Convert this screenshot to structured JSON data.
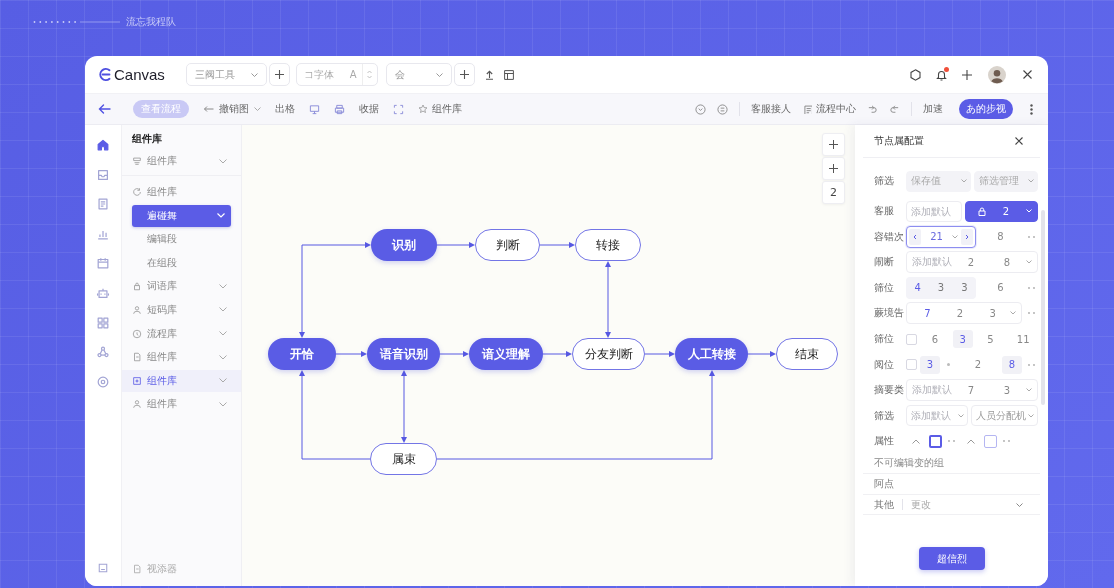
{
  "backdrop": {
    "caption": "流忘我程队"
  },
  "header": {
    "logo": "Canvas",
    "tool_select": {
      "value": "三阀工具"
    },
    "font_field": {
      "placeholder": "コ字体",
      "suffix": "A"
    },
    "style_select": {
      "value": "会"
    },
    "notifications": {
      "unread": true
    }
  },
  "toolbar": {
    "view_button": {
      "label": "查看流程",
      "disabled": true
    },
    "undo_menu": {
      "label": "撤销图"
    },
    "left_items": [
      {
        "kind": "text",
        "label": "出格"
      },
      {
        "kind": "icon"
      },
      {
        "kind": "icon"
      },
      {
        "kind": "text",
        "label": "收据"
      },
      {
        "kind": "icon"
      },
      {
        "kind": "icon-text",
        "label": "组件库"
      }
    ],
    "right_items": [
      {
        "kind": "icon"
      },
      {
        "kind": "icon"
      },
      {
        "kind": "divider"
      },
      {
        "kind": "text",
        "label": "客服接人"
      },
      {
        "kind": "icon-text",
        "label": "流程中心"
      },
      {
        "kind": "icon"
      },
      {
        "kind": "icon"
      },
      {
        "kind": "divider"
      },
      {
        "kind": "text",
        "label": "加速"
      }
    ],
    "primary_button": {
      "label": "あ的步视"
    }
  },
  "rail": {
    "items": [
      {
        "selected": true
      },
      {
        "selected": false
      },
      {
        "selected": false
      },
      {
        "selected": false
      },
      {
        "selected": false
      },
      {
        "selected": false
      },
      {
        "selected": false
      },
      {
        "selected": false
      },
      {
        "selected": false
      }
    ]
  },
  "components": {
    "title": "组件库",
    "category": {
      "label": "组件库"
    },
    "items": [
      {
        "label": "组件库",
        "expandable": false,
        "selected": false,
        "highlighted": false,
        "children": [
          {
            "label": "遍碰舞",
            "expandable": true,
            "selected": true,
            "highlighted": false
          },
          {
            "label": "编辑段",
            "expandable": false,
            "selected": false,
            "highlighted": false
          },
          {
            "label": "在组段",
            "expandable": false,
            "selected": false,
            "highlighted": false
          }
        ]
      },
      {
        "label": "词语库",
        "expandable": true,
        "selected": false,
        "highlighted": false
      },
      {
        "label": "短码库",
        "expandable": true,
        "selected": false,
        "highlighted": false
      },
      {
        "label": "流程库",
        "expandable": true,
        "selected": false,
        "highlighted": false
      },
      {
        "label": "组件库",
        "expandable": true,
        "selected": false,
        "highlighted": false
      },
      {
        "label": "组件库",
        "expandable": true,
        "selected": false,
        "highlighted": true
      },
      {
        "label": "组件库",
        "expandable": true,
        "selected": false,
        "highlighted": false
      }
    ],
    "footer": {
      "label": "视添器"
    }
  },
  "flow": {
    "nodes": [
      {
        "label": "识别",
        "kind": "filled"
      },
      {
        "label": "判断",
        "kind": "outline"
      },
      {
        "label": "转接",
        "kind": "outline"
      },
      {
        "label": "开恰",
        "kind": "filled"
      },
      {
        "label": "语音识别",
        "kind": "filled"
      },
      {
        "label": "谙义理解",
        "kind": "filled"
      },
      {
        "label": "分友判断",
        "kind": "outline"
      },
      {
        "label": "人工转接",
        "kind": "filled"
      },
      {
        "label": "结束",
        "kind": "outline"
      },
      {
        "label": "属束",
        "kind": "outline"
      }
    ],
    "connectors": [
      {
        "kind": "double"
      },
      {
        "kind": "arrow"
      },
      {
        "kind": "arrow"
      },
      {
        "kind": "double"
      },
      {
        "kind": "arrow"
      },
      {
        "kind": "arrow"
      },
      {
        "kind": "arrow"
      },
      {
        "kind": "arrow"
      },
      {
        "kind": "arrow"
      },
      {
        "kind": "double"
      },
      {
        "kind": "arrow"
      },
      {
        "kind": "arrow"
      }
    ],
    "zoom_controls": [
      {
        "kind": "plus"
      },
      {
        "kind": "plus"
      },
      {
        "kind": "text",
        "label": "2"
      }
    ]
  },
  "properties": {
    "title": "节点属配置",
    "rows": [
      {
        "label": "筛选",
        "controls": [
          {
            "kind": "select",
            "value": "保存值",
            "active": false,
            "disabled": true
          },
          {
            "kind": "select",
            "value": "筛选管理",
            "active": false,
            "disabled": true
          }
        ]
      },
      {
        "label": "客服",
        "controls": [
          {
            "kind": "input",
            "placeholder": "添加默认"
          },
          {
            "kind": "select",
            "value": "2",
            "active": true,
            "disabled": false
          }
        ]
      },
      {
        "label": "容错次",
        "controls": [
          {
            "kind": "stepper",
            "value": "21",
            "focused": true
          },
          {
            "kind": "number",
            "value": "8"
          },
          {
            "kind": "more"
          }
        ]
      },
      {
        "label": "闹断",
        "controls": [
          {
            "kind": "combo",
            "placeholder": "添加默认",
            "values": [
              "2",
              "8"
            ]
          }
        ]
      },
      {
        "label": "筛位",
        "controls": [
          {
            "kind": "segmented",
            "values": [
              "4",
              "3",
              "3"
            ]
          },
          {
            "kind": "number",
            "value": "6"
          },
          {
            "kind": "more"
          }
        ]
      },
      {
        "label": "蕨境告",
        "controls": [
          {
            "kind": "combo",
            "values": [
              "7",
              "2",
              "3"
            ]
          },
          {
            "kind": "more"
          }
        ]
      },
      {
        "label": "筛位",
        "controls": [
          {
            "kind": "checkbox",
            "checked": false
          },
          {
            "kind": "number",
            "value": "6"
          },
          {
            "kind": "chip",
            "value": "3"
          },
          {
            "kind": "number",
            "value": "5"
          },
          {
            "kind": "number",
            "value": "11"
          }
        ]
      },
      {
        "label": "阅位",
        "controls": [
          {
            "kind": "checkbox",
            "checked": false
          },
          {
            "kind": "chip",
            "value": "3"
          },
          {
            "kind": "dot"
          },
          {
            "kind": "number",
            "value": "2"
          },
          {
            "kind": "chip",
            "value": "8"
          },
          {
            "kind": "more"
          }
        ]
      },
      {
        "label": "摘要类",
        "controls": [
          {
            "kind": "combo",
            "placeholder": "添加默认",
            "values": [
              "7",
              "3"
            ]
          }
        ]
      },
      {
        "label": "筛选",
        "controls": [
          {
            "kind": "select",
            "placeholder": "添加默认",
            "active": false,
            "disabled": false
          },
          {
            "kind": "select",
            "value": "人员分配机",
            "active": false,
            "disabled": false
          }
        ]
      },
      {
        "label": "属性",
        "controls": [
          {
            "kind": "caret"
          },
          {
            "kind": "option",
            "selected": true
          },
          {
            "kind": "more"
          },
          {
            "kind": "caret"
          },
          {
            "kind": "option",
            "selected": false
          },
          {
            "kind": "more"
          }
        ]
      }
    ],
    "note": "不可编辑变的组",
    "sections": [
      {
        "kind": "plain",
        "label": "阿点"
      },
      {
        "kind": "select",
        "label": "其他",
        "value": "更改"
      }
    ],
    "save_button": {
      "label": "超信烈"
    }
  }
}
